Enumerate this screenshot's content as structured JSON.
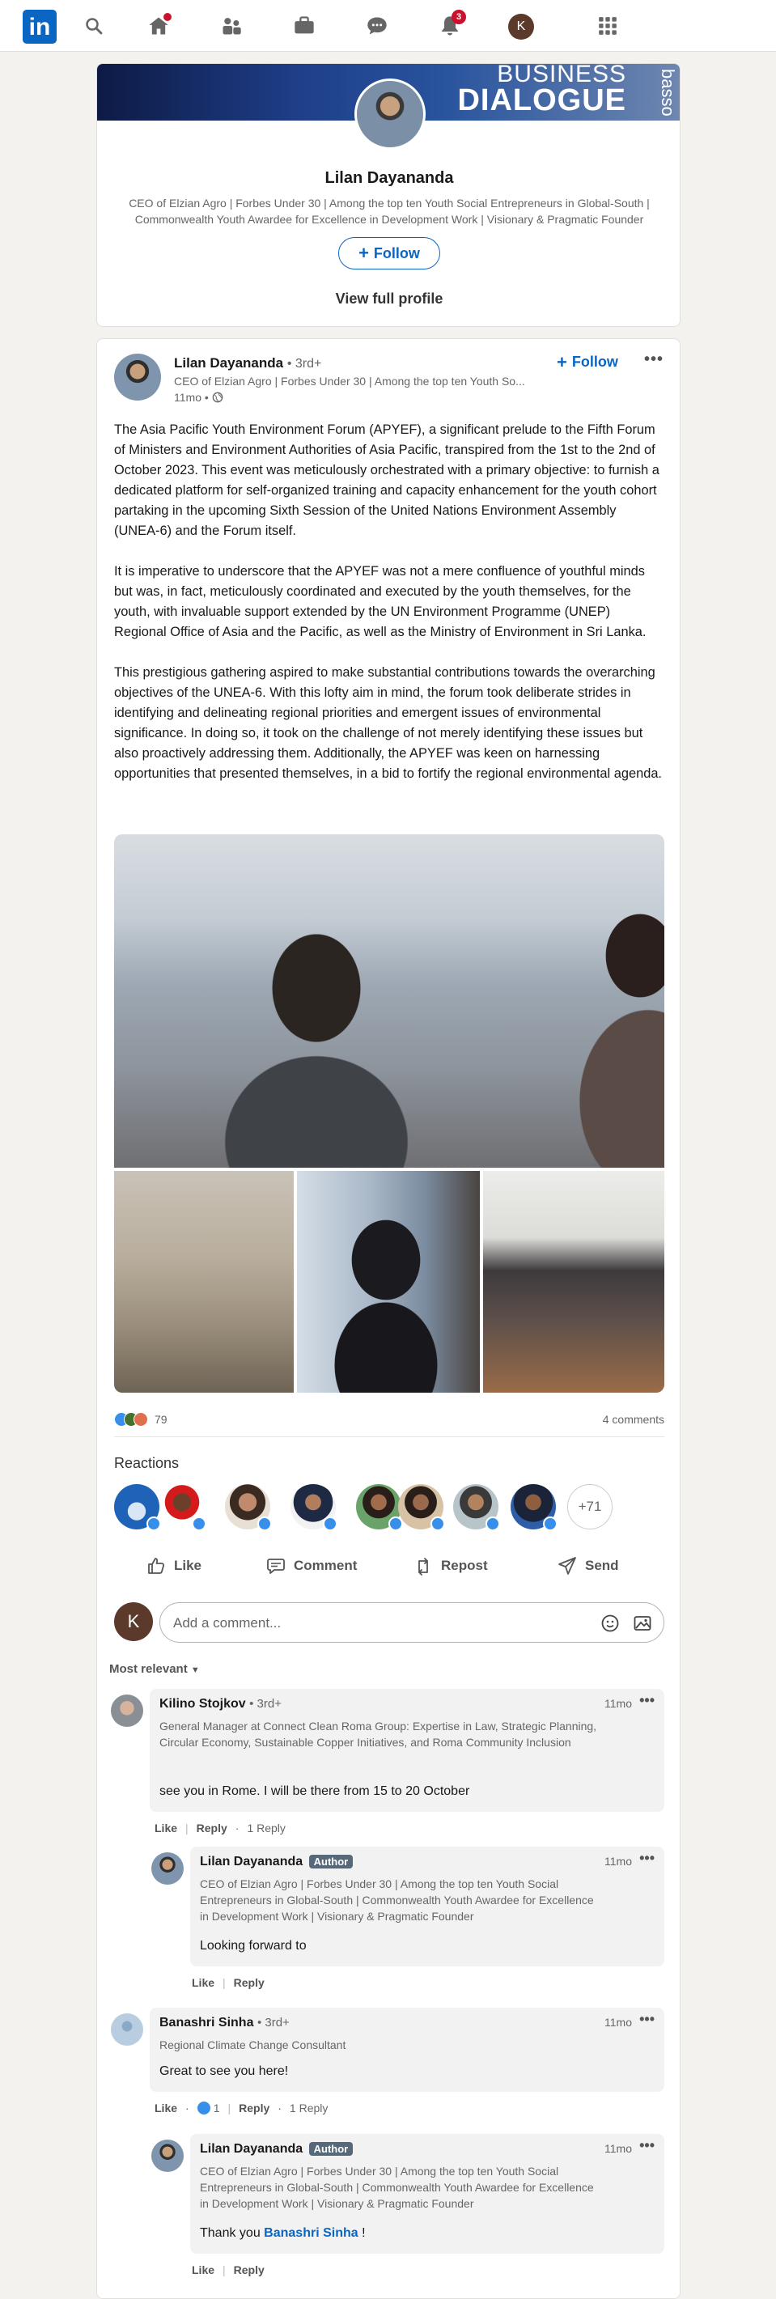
{
  "nav": {
    "logo": "in",
    "notifications_badge": "3"
  },
  "profile_card": {
    "banner_line1": "BUSINESS",
    "banner_line2": "DIALOGUE",
    "banner_side": "basso",
    "name": "Lilan Dayananda",
    "headline": "CEO of Elzian Agro | Forbes Under 30 | Among the top ten Youth Social Entrepreneurs in Global-South | Commonwealth Youth Awardee for Excellence in Development Work | Visionary & Pragmatic Founder",
    "follow_label": "Follow",
    "view_profile_label": "View full profile"
  },
  "post": {
    "author_name": "Lilan Dayananda",
    "author_degree": "• 3rd+",
    "author_headline": "CEO of Elzian Agro | Forbes Under 30 | Among the top ten Youth So...",
    "time": "11mo •",
    "follow_label": "Follow",
    "paragraphs": [
      "The Asia Pacific Youth Environment Forum (APYEF), a significant prelude to the Fifth Forum of Ministers and Environment Authorities of Asia Pacific, transpired from the 1st to the 2nd of October 2023. This event was meticulously orchestrated with a primary objective: to furnish a dedicated platform for self-organized training and capacity enhancement for the youth cohort partaking in the upcoming Sixth Session of the United Nations Environment Assembly (UNEA-6) and the Forum itself.",
      "It is imperative to underscore that the APYEF was not a mere confluence of youthful minds but was, in fact, meticulously coordinated and executed by the youth themselves, for the youth, with invaluable support extended by the UN Environment Programme (UNEP) Regional Office of Asia and the Pacific, as well as the Ministry of Environment in Sri Lanka.",
      "This prestigious gathering aspired to make substantial contributions towards the overarching objectives of the UNEA-6. With this lofty aim in mind, the forum took deliberate strides in identifying and delineating regional priorities and emergent issues of environmental significance. In doing so, it took on the challenge of not merely identifying these issues but also proactively addressing them. Additionally, the APYEF was keen on harnessing opportunities that presented themselves, in a bid to fortify the regional environmental agenda."
    ],
    "reaction_count": "79",
    "comment_count": "4 comments",
    "reactions_title": "Reactions",
    "more_reactors": "+71",
    "actions": {
      "like": "Like",
      "comment": "Comment",
      "repost": "Repost",
      "send": "Send"
    },
    "add_comment_placeholder": "Add a comment...",
    "viewer_initial": "K",
    "sort_label": "Most relevant"
  },
  "comments": [
    {
      "name": "Kilino Stojkov",
      "degree": "• 3rd+",
      "headline": "General Manager at Connect Clean Roma Group: Expertise in Law, Strategic Planning, Circular Economy, Sustainable Copper Initiatives, and Roma Community Inclusion",
      "time": "11mo",
      "text": "see you in Rome. I will be there from 15 to 20 October",
      "like": "Like",
      "reply": "Reply",
      "replies": "1 Reply"
    },
    {
      "name": "Lilan Dayananda",
      "tag": "Author",
      "headline": "CEO of Elzian Agro | Forbes Under 30 | Among the top ten Youth Social Entrepreneurs in Global-South | Commonwealth Youth Awardee for Excellence in Development Work | Visionary & Pragmatic Founder",
      "time": "11mo",
      "text": "Looking forward to",
      "like": "Like",
      "reply": "Reply"
    },
    {
      "name": "Banashri Sinha",
      "degree": "• 3rd+",
      "headline": "Regional Climate Change Consultant",
      "time": "11mo",
      "text": "Great to see you here!",
      "like": "Like",
      "like_count": "1",
      "reply": "Reply",
      "replies": "1 Reply"
    },
    {
      "name": "Lilan Dayananda",
      "tag": "Author",
      "headline": "CEO of Elzian Agro | Forbes Under 30 | Among the top ten Youth Social Entrepreneurs in Global-South | Commonwealth Youth Awardee for Excellence in Development Work | Visionary & Pragmatic Founder",
      "time": "11mo",
      "text_prefix": "Thank you",
      "mention": "Banashri Sinha",
      "text_suffix": "!",
      "like": "Like",
      "reply": "Reply"
    }
  ],
  "colors": {
    "brand": "#0a66c2",
    "badge": "#cb112d",
    "like": "#378fe9"
  }
}
